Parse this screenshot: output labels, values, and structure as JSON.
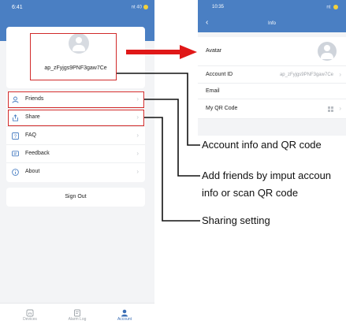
{
  "left_screen": {
    "status": {
      "time": "6:41",
      "icons": "nt 40"
    },
    "profile": {
      "account_id": "ap_zFyjgs9PNF3gaw7Ce"
    },
    "menu": [
      {
        "label": "Friends",
        "icon": "person-icon"
      },
      {
        "label": "Share",
        "icon": "share-icon"
      },
      {
        "label": "FAQ",
        "icon": "question-icon"
      },
      {
        "label": "Feedback",
        "icon": "feedback-icon"
      },
      {
        "label": "About",
        "icon": "info-icon"
      }
    ],
    "sign_out_label": "Sign Out",
    "tabs": [
      {
        "label": "Devices",
        "icon": "home-icon"
      },
      {
        "label": "Alarm Log",
        "icon": "clipboard-icon"
      },
      {
        "label": "Account",
        "icon": "person-icon",
        "active": true
      }
    ]
  },
  "right_screen": {
    "status": {
      "time": "10:35",
      "icons": "nt"
    },
    "title": "Info",
    "rows": {
      "avatar": "Avatar",
      "account_id_label": "Account ID",
      "account_id_value": "ap_zFyjgs9PNF3gaw7Ce",
      "email": "Email",
      "qr_code": "My QR Code"
    }
  },
  "annotations": {
    "account_info": "Account info and QR code",
    "friends_line1": "Add friends by imput accoun",
    "friends_line2": "info or scan QR code",
    "sharing": "Sharing setting"
  },
  "colors": {
    "header_blue": "#4a7fc3",
    "highlight_red": "#d12a2a",
    "arrow_red": "#e01818"
  }
}
